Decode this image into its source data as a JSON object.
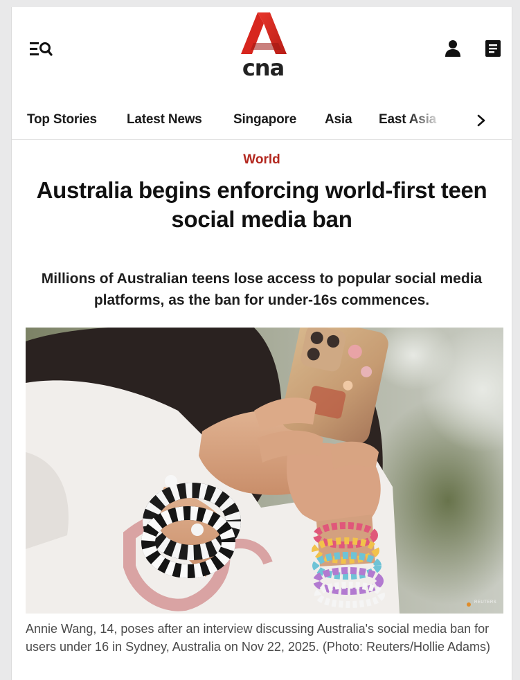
{
  "header": {
    "logo_text": "cna",
    "menu_icon": "menu-search-icon",
    "account_icon": "user-icon",
    "briefing_icon": "document-icon"
  },
  "nav": {
    "items": [
      "Top Stories",
      "Latest News",
      "Singapore",
      "Asia",
      "East Asia"
    ],
    "next_icon": "chevron-right-icon"
  },
  "article": {
    "category": "World",
    "headline": "Australia begins enforcing world-first teen social media ban",
    "standfirst": "Millions of Australian teens lose access to popular social media platforms, as the ban for under-16s commences.",
    "image": {
      "description_icon": "photo-teen-holding-smartphone",
      "watermark": "REUTERS"
    },
    "caption": "Annie Wang, 14, poses after an interview discussing Australia's social media ban for users under 16 in Sydney, Australia on Nov 22, 2025. (Photo: Reuters/Hollie Adams)"
  },
  "colors": {
    "brand_red": "#d7261e",
    "category_red": "#b3281f",
    "text_dark": "#111111",
    "caption_gray": "#4a4a4a"
  }
}
